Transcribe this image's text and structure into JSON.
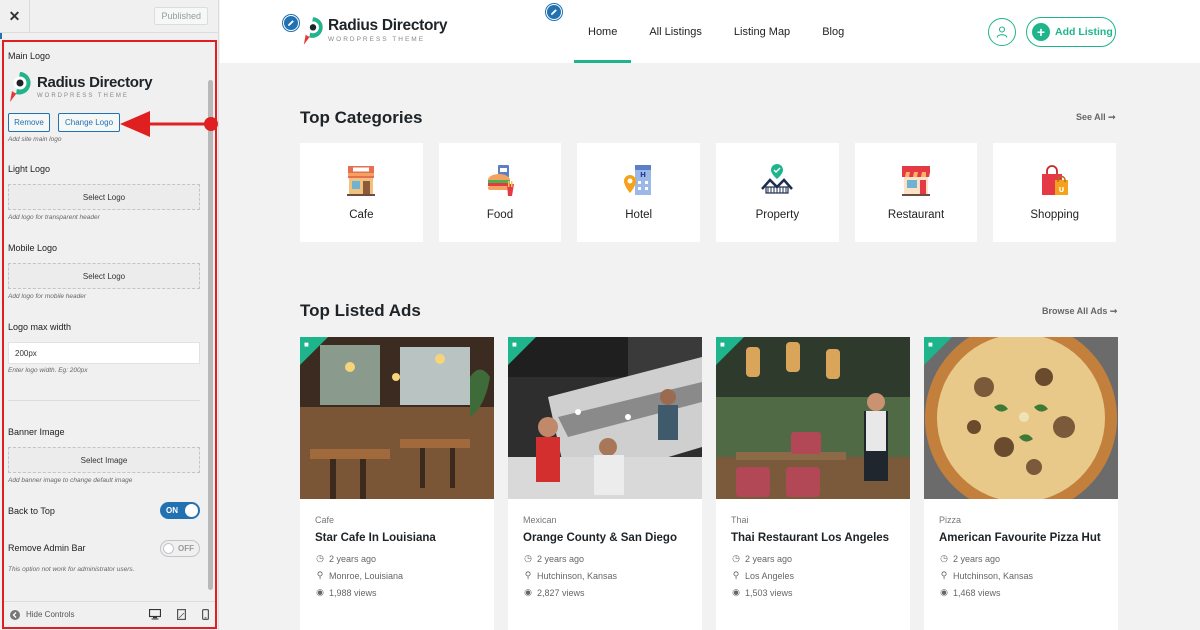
{
  "customizer": {
    "close_glyph": "✕",
    "publish_status": "Published",
    "main_logo_label": "Main Logo",
    "logo_title": "Radius Directory",
    "logo_subtitle": "WORDPRESS THEME",
    "remove_label": "Remove",
    "change_logo_label": "Change Logo",
    "main_logo_hint": "Add site main logo",
    "light_logo_label": "Light Logo",
    "light_logo_button": "Select Logo",
    "light_logo_hint": "Add logo for transparent header",
    "mobile_logo_label": "Mobile Logo",
    "mobile_logo_button": "Select Logo",
    "mobile_logo_hint": "Add logo for mobile header",
    "logo_max_width_label": "Logo max width",
    "logo_max_width_value": "200px",
    "logo_max_width_hint": "Enter logo width. Eg: 200px",
    "banner_image_label": "Banner Image",
    "banner_image_button": "Select Image",
    "banner_image_hint": "Add banner image to change default image",
    "back_to_top_label": "Back to Top",
    "back_to_top_state": "ON",
    "remove_admin_bar_label": "Remove Admin Bar",
    "remove_admin_bar_state": "OFF",
    "remove_admin_bar_hint": "This option not work for administrator users.",
    "hide_controls_label": "Hide Controls"
  },
  "site": {
    "logo_title": "Radius Directory",
    "logo_subtitle": "WORDPRESS THEME",
    "nav": [
      "Home",
      "All Listings",
      "Listing Map",
      "Blog"
    ],
    "active_nav": "Home",
    "add_listing_label": "Add Listing",
    "categories_title": "Top Categories",
    "categories_link": "See All ➞",
    "categories": [
      {
        "name": "Cafe",
        "icon": "cafe-icon"
      },
      {
        "name": "Food",
        "icon": "food-icon"
      },
      {
        "name": "Hotel",
        "icon": "hotel-icon"
      },
      {
        "name": "Property",
        "icon": "property-icon"
      },
      {
        "name": "Restaurant",
        "icon": "restaurant-icon"
      },
      {
        "name": "Shopping",
        "icon": "shopping-icon"
      }
    ],
    "listings_title": "Top Listed Ads",
    "listings_link": "Browse All Ads ➞",
    "listings": [
      {
        "category": "Cafe",
        "title": "Star Cafe In Louisiana",
        "time": "2 years ago",
        "location": "Monroe,  Louisiana",
        "views": "1,988 views"
      },
      {
        "category": "Mexican",
        "title": "Orange County & San Diego",
        "time": "2 years ago",
        "location": "Hutchinson,  Kansas",
        "views": "2,827 views"
      },
      {
        "category": "Thai",
        "title": "Thai Restaurant Los Angeles",
        "time": "2 years ago",
        "location": "Los Angeles",
        "views": "1,503 views"
      },
      {
        "category": "Pizza",
        "title": "American Favourite Pizza Hut",
        "time": "2 years ago",
        "location": "Hutchinson,  Kansas",
        "views": "1,468 views"
      }
    ]
  },
  "colors": {
    "accent": "#1fb58c",
    "wp_blue": "#2271b1",
    "highlight_red": "#e02020"
  }
}
